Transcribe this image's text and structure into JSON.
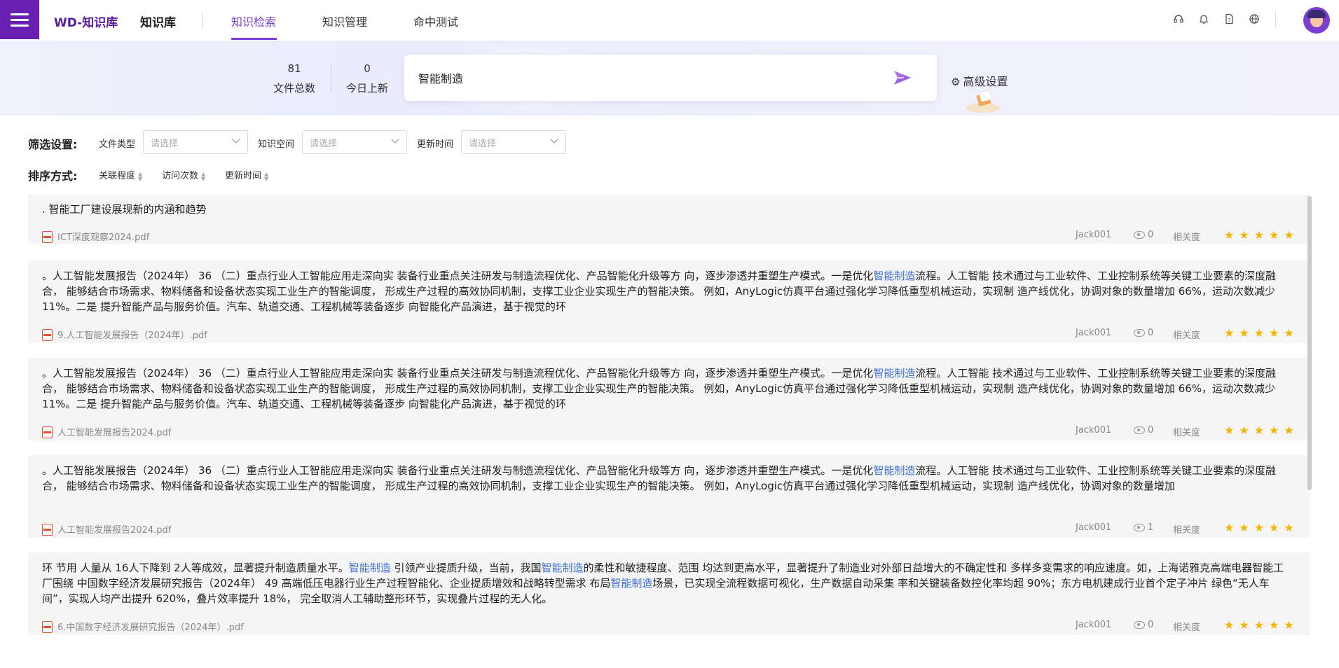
{
  "header": {
    "brand": "WD-知识库",
    "kb_label": "知识库",
    "nav": [
      {
        "label": "知识检索",
        "active": true
      },
      {
        "label": "知识管理",
        "active": false
      },
      {
        "label": "命中测试",
        "active": false
      }
    ],
    "icons": [
      "headset-icon",
      "bell-icon",
      "help-document-icon",
      "globe-icon"
    ],
    "accent_color": "#7b3ed6",
    "menu_color": "#6a1fb3"
  },
  "stats": {
    "total_files_value": "81",
    "total_files_label": "文件总数",
    "today_new_value": "0",
    "today_new_label": "今日上新"
  },
  "search": {
    "query": "智能制造",
    "advanced_label": "高级设置"
  },
  "filters": {
    "title": "筛选设置:",
    "items": [
      {
        "label": "文件类型",
        "placeholder": "请选择"
      },
      {
        "label": "知识空间",
        "placeholder": "请选择"
      },
      {
        "label": "更新时间",
        "placeholder": "请选择"
      }
    ]
  },
  "sorting": {
    "title": "排序方式:",
    "options": [
      "关联程度",
      "访问次数",
      "更新时间"
    ]
  },
  "results": [
    {
      "segments": [
        {
          "t": ". 智能工厂建设展现新的内涵和趋势",
          "h": false
        }
      ],
      "file": "ICT深度观察2024.pdf",
      "author": "Jack001",
      "views": "0",
      "relevance_label": "相关度",
      "stars": 5
    },
    {
      "segments": [
        {
          "t": "。人工智能发展报告（2024年） 36 （二）重点行业人工智能应用走深向实 装备行业重点关注研发与制造流程优化、产品智能化升级等方 向，逐步渗透并重塑生产模式。一是优化",
          "h": false
        },
        {
          "t": "智能制造",
          "h": true
        },
        {
          "t": "流程。人工智能 技术通过与工业软件、工业控制系统等关键工业要素的深度融合， 能够结合市场需求、物料储备和设备状态实现工业生产的智能调度， 形成生产过程的高效协同机制，支撑工业企业实现生产的智能决策。 例如，AnyLogic仿真平台通过强化学习降低重型机械运动，实现制 造产线优化，协调对象的数量增加 66%，运动次数减少 11%。二是 提升智能产品与服务价值。汽车、轨道交通、工程机械等装备逐步 向智能化产品演进，基于视觉的环",
          "h": false
        }
      ],
      "file": "9.人工智能发展报告（2024年）.pdf",
      "author": "Jack001",
      "views": "0",
      "relevance_label": "相关度",
      "stars": 5
    },
    {
      "segments": [
        {
          "t": "。人工智能发展报告（2024年） 36 （二）重点行业人工智能应用走深向实 装备行业重点关注研发与制造流程优化、产品智能化升级等方 向，逐步渗透并重塑生产模式。一是优化",
          "h": false
        },
        {
          "t": "智能制造",
          "h": true
        },
        {
          "t": "流程。人工智能 技术通过与工业软件、工业控制系统等关键工业要素的深度融合， 能够结合市场需求、物料储备和设备状态实现工业生产的智能调度， 形成生产过程的高效协同机制，支撑工业企业实现生产的智能决策。 例如，AnyLogic仿真平台通过强化学习降低重型机械运动，实现制 造产线优化，协调对象的数量增加 66%，运动次数减少 11%。二是 提升智能产品与服务价值。汽车、轨道交通、工程机械等装备逐步 向智能化产品演进，基于视觉的环",
          "h": false
        }
      ],
      "file": "人工智能发展报告2024.pdf",
      "author": "Jack001",
      "views": "0",
      "relevance_label": "相关度",
      "stars": 5
    },
    {
      "segments": [
        {
          "t": "。人工智能发展报告（2024年） 36 （二）重点行业人工智能应用走深向实 装备行业重点关注研发与制造流程优化、产品智能化升级等方 向，逐步渗透并重塑生产模式。一是优化",
          "h": false
        },
        {
          "t": "智能制造",
          "h": true
        },
        {
          "t": "流程。人工智能 技术通过与工业软件、工业控制系统等关键工业要素的深度融合， 能够结合市场需求、物料储备和设备状态实现工业生产的智能调度， 形成生产过程的高效协同机制，支撑工业企业实现生产的智能决策。 例如，AnyLogic仿真平台通过强化学习降低重型机械运动，实现制 造产线优化，协调对象的数量增加",
          "h": false
        }
      ],
      "file": "人工智能发展报告2024.pdf",
      "author": "Jack001",
      "views": "1",
      "relevance_label": "相关度",
      "stars": 5
    },
    {
      "segments": [
        {
          "t": "环 节用 人量从 16人下降到 2人等成效，显著提升制造质量水平。",
          "h": false
        },
        {
          "t": "智能制造",
          "h": true
        },
        {
          "t": " 引领产业提质升级，当前，我国",
          "h": false
        },
        {
          "t": "智能制造",
          "h": true
        },
        {
          "t": "的柔性和敏捷程度、范围 均达到更高水平，显著提升了制造业对外部日益增大的不确定性和 多样多变需求的响应速度。如，上海诺雅克高端电器智能工厂围绕 中国数字经济发展研究报告（2024年） 49 高端低压电器行业生产过程智能化、企业提质增效和战略转型需求 布局",
          "h": false
        },
        {
          "t": "智能制造",
          "h": true
        },
        {
          "t": "场景，已实现全流程数据可视化，生产数据自动采集 率和关键装备数控化率均超 90%；东方电机建成行业首个定子冲片 绿色“无人车间”，实现人均产出提升 620%，叠片效率提升 18%， 完全取消人工辅助整形环节，实现叠片过程的无人化。",
          "h": false
        }
      ],
      "file": "6.中国数字经济发展研究报告（2024年）.pdf",
      "author": "Jack001",
      "views": "0",
      "relevance_label": "相关度",
      "stars": 5
    }
  ]
}
